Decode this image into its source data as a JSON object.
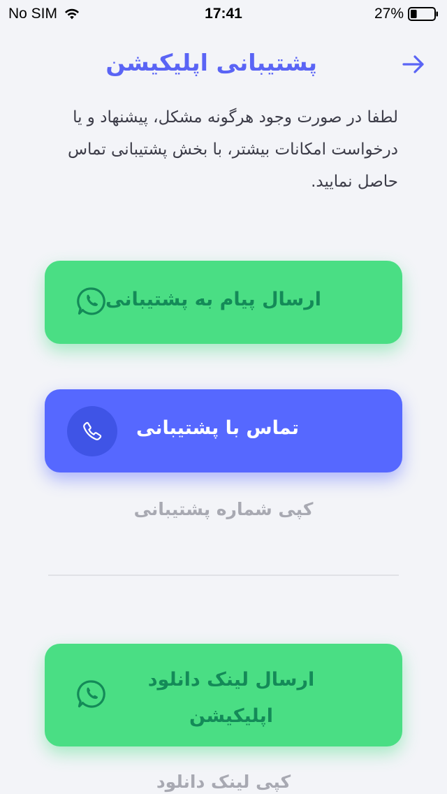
{
  "status_bar": {
    "carrier": "No SIM",
    "time": "17:41",
    "battery_percent": "27%",
    "battery_level": 0.27,
    "wifi_icon": "wifi-icon",
    "battery_icon": "battery-icon"
  },
  "header": {
    "title": "پشتیبانی اپلیکیشن",
    "back_icon": "arrow-right-icon"
  },
  "description": "لطفا در صورت وجود هرگونه مشکل، پیشنهاد و یا درخواست امکانات بیشتر، با بخش پشتیبانی تماس حاصل نمایید.",
  "buttons": {
    "whatsapp_support": {
      "label": "ارسال پیام به پشتیبانی",
      "icon": "whatsapp-icon"
    },
    "call_support": {
      "label": "تماس با پشتیبانی",
      "icon": "phone-icon"
    },
    "copy_number": {
      "label": "کپی شماره پشتیبانی"
    },
    "send_download_link": {
      "label_line1": "ارسال لینک دانلود",
      "label_line2": "اپلیکیشن",
      "icon": "whatsapp-icon"
    },
    "copy_download_link": {
      "label": "کپی لینک دانلود"
    }
  },
  "colors": {
    "accent_blue": "#5668ff",
    "title_blue": "#5a64f5",
    "green": "#4ade84",
    "green_text": "#148a58",
    "muted_text": "#a8a9b2",
    "background": "#f3f4f8"
  }
}
